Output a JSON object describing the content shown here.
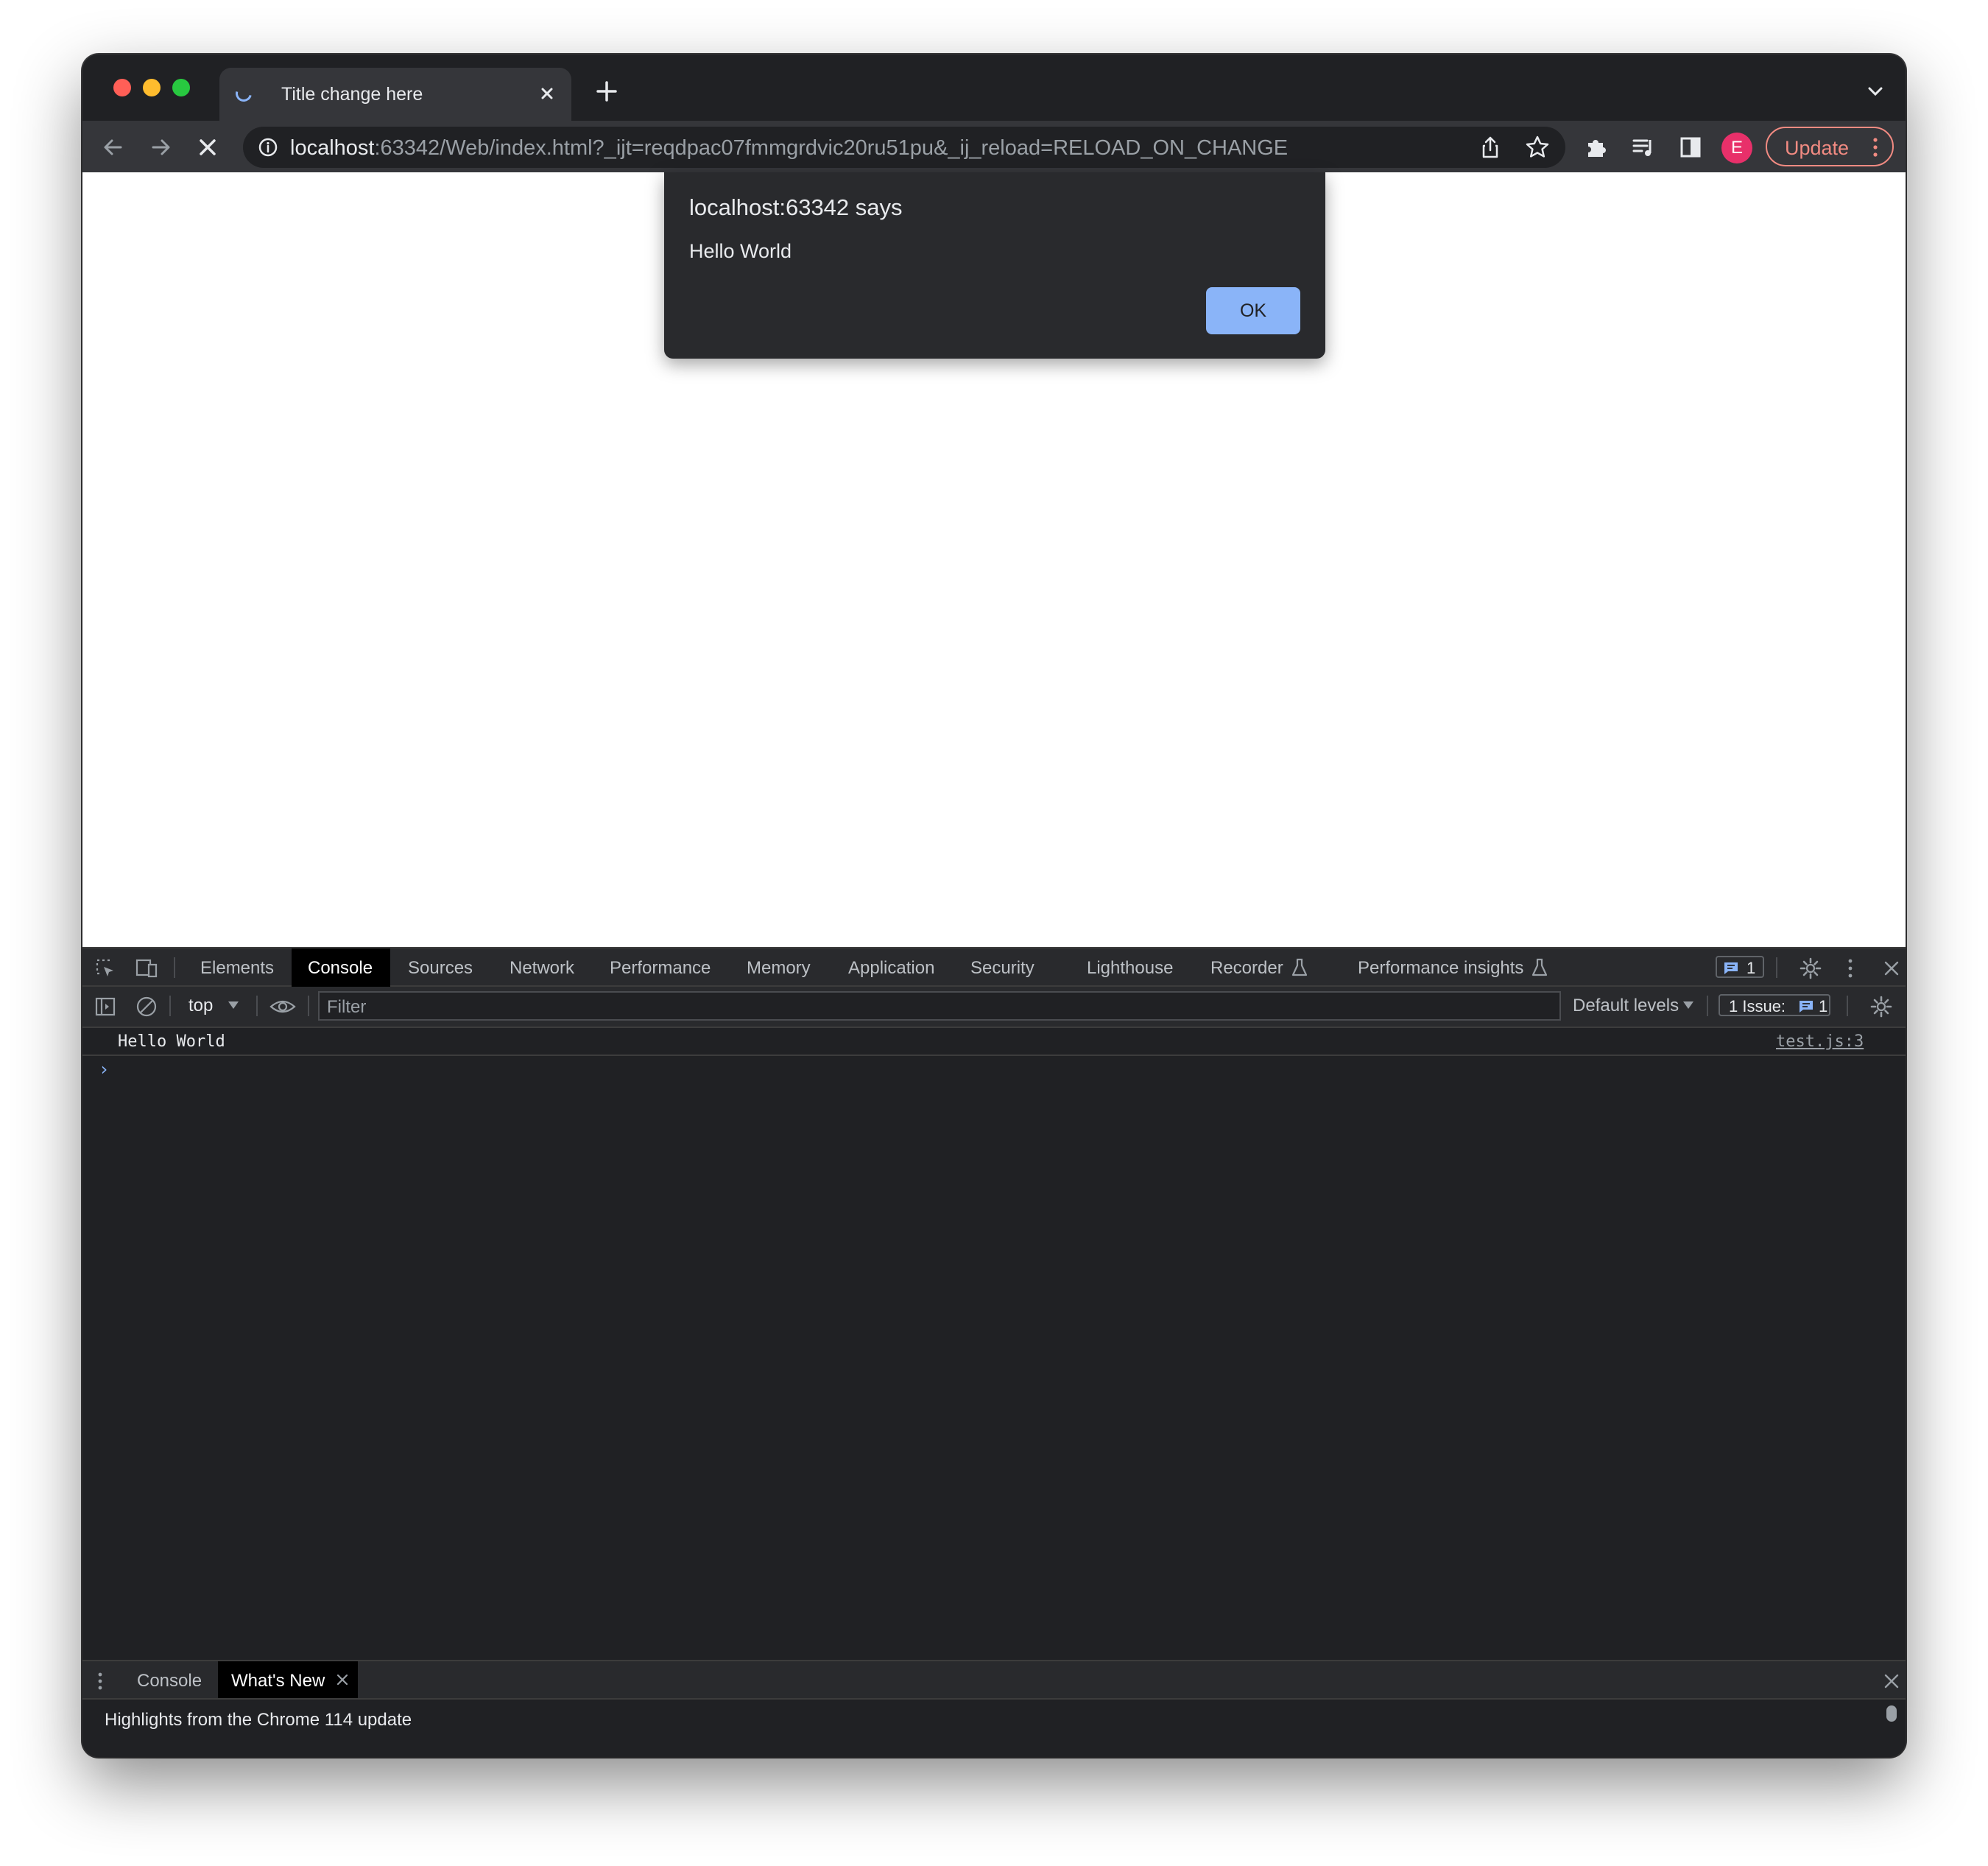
{
  "browser": {
    "tab": {
      "title": "Title change here"
    },
    "address": {
      "host": "localhost",
      "rest": ":63342/Web/index.html?_ijt=reqdpac07fmmgrdvic20ru51pu&_ij_reload=RELOAD_ON_CHANGE"
    },
    "profile_initial": "E",
    "update_label": "Update"
  },
  "dialog": {
    "title": "localhost:63342 says",
    "message": "Hello World",
    "ok_label": "OK"
  },
  "devtools": {
    "tabs": [
      "Elements",
      "Console",
      "Sources",
      "Network",
      "Performance",
      "Memory",
      "Application",
      "Security",
      "Lighthouse",
      "Recorder",
      "Performance insights"
    ],
    "active_tab": "Console",
    "messages_badge": "1",
    "console": {
      "context": "top",
      "filter_placeholder": "Filter",
      "levels": "Default levels",
      "issues_label": "1 Issue:",
      "issues_count": "1",
      "log": [
        {
          "message": "Hello World",
          "source": "test.js:3"
        }
      ],
      "prompt": "›"
    },
    "drawer": {
      "tabs": [
        "Console",
        "What's New"
      ],
      "active_tab": "What's New",
      "content": "Highlights from the Chrome 114 update"
    }
  },
  "colors": {
    "traffic_close": "#ff5f57",
    "traffic_min": "#febc2e",
    "traffic_max": "#28c840",
    "accent_blue": "#8ab4f8",
    "update_red": "#f28b82",
    "profile_pink": "#e8306a"
  }
}
